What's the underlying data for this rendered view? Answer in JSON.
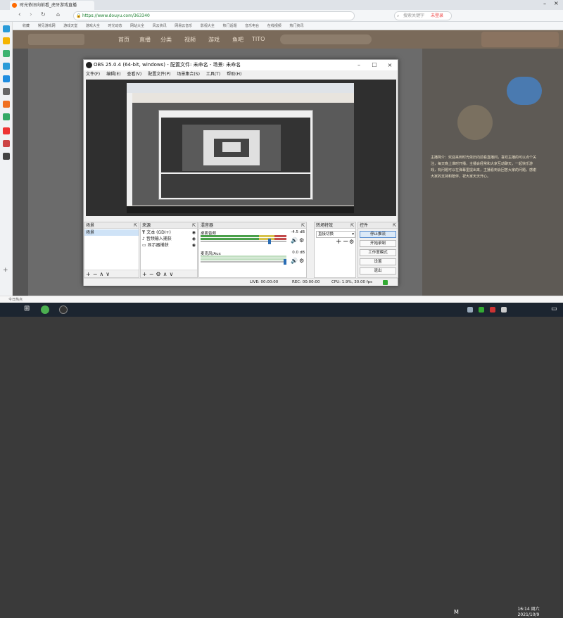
{
  "browser": {
    "tab_title": "时光依旧向前看_虎牙游戏直播",
    "url": "https://www.douyu.com/363340",
    "search_placeholder": "搜索关键字",
    "user_label": "未登录",
    "bookmarks": [
      "收藏",
      "常见游戏网",
      "游戏天堂",
      "游戏大全",
      "时光动态",
      "网站大全",
      "风云资讯",
      "网易云音乐",
      "影视大全",
      "热门话题",
      "音乐电台",
      "在线视频",
      "热门资讯"
    ]
  },
  "site": {
    "nav_items": [
      "首页",
      "直播",
      "分类",
      "视频",
      "游戏",
      "鱼吧",
      "TITO"
    ],
    "right_text": "主播简介：欢迎来到时光依旧向前看直播间，喜欢主播的可以点个关注，每天晚上准时开播，主播会经常和大家互动聊天，一起快乐游戏，有问题可以在弹幕里提出来，主播看到会回答大家的问题，感谢大家的支持和陪伴，祝大家天天开心。"
  },
  "obs": {
    "title": "OBS 25.0.4 (64-bit, windows) - 配置文件: 未命名 - 场景: 未命名",
    "menu": [
      "文件(F)",
      "编辑(E)",
      "查看(V)",
      "配置文件(P)",
      "场景集合(S)",
      "工具(T)",
      "帮助(H)"
    ],
    "docks": {
      "scenes": {
        "title": "场景",
        "items": [
          "场景"
        ]
      },
      "sources": {
        "title": "来源",
        "items": [
          "文本 (GDI+)",
          "音频输入捕获",
          "显示器捕获"
        ]
      },
      "mixer": {
        "title": "混音器",
        "channels": [
          {
            "name": "桌面音频",
            "db": "-4.5 dB"
          },
          {
            "name": "麦克风/Aux",
            "db": "0.0 dB"
          }
        ]
      },
      "transitions": {
        "title": "转场特效",
        "type": "直接切换"
      },
      "controls": {
        "title": "控件",
        "buttons": [
          "停止推流",
          "开始录制",
          "工作室模式",
          "设置",
          "退出"
        ]
      }
    },
    "status": {
      "live": "LIVE: 00:00:00",
      "rec": "REC: 00:00:00",
      "cpu": "CPU: 1.9%, 30.00 fps"
    }
  },
  "notice": "今日热点",
  "taskbar": {
    "lang": "M",
    "time": "16:14 周六",
    "date": "2021/10/9"
  }
}
